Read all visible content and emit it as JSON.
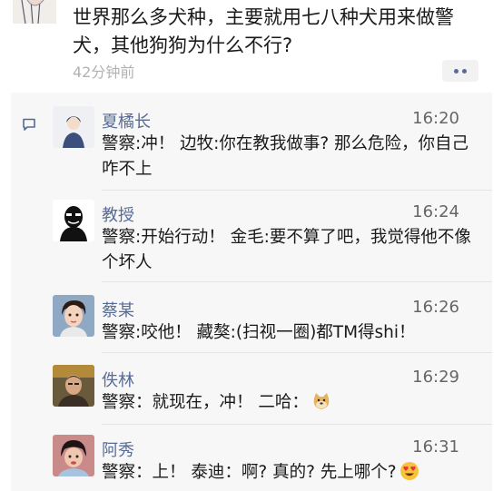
{
  "post": {
    "text": "世界那么多犬种，主要就用七八种犬用来做警犬，其他狗狗为什么不行?",
    "time": "42分钟前"
  },
  "comments": [
    {
      "name": "夏橘长",
      "time": "16:20",
      "text": "警察:冲！ 边牧:你在教我做事? 那么危险，你自己咋不上"
    },
    {
      "name": "教授",
      "time": "16:24",
      "text": "警察:开始行动！ 金毛:要不算了吧，我觉得他不像个坏人"
    },
    {
      "name": "蔡某",
      "time": "16:26",
      "text": "警察:咬他！ 藏獒:(扫视一圈)都TM得shi！"
    },
    {
      "name": "佚林",
      "time": "16:29",
      "text": "警察：就现在，冲！ 二哈："
    },
    {
      "name": "阿秀",
      "time": "16:31",
      "text": "警察：上！ 泰迪：啊? 真的? 先上哪个?"
    }
  ],
  "icons": {
    "comment": "comment-bubble-icon",
    "more": "more-dots-icon",
    "doge": "doge-emoji-icon",
    "heart_eyes": "heart-eyes-emoji-icon"
  },
  "colors": {
    "name": "#576b95",
    "panel": "#f7f7f7"
  }
}
